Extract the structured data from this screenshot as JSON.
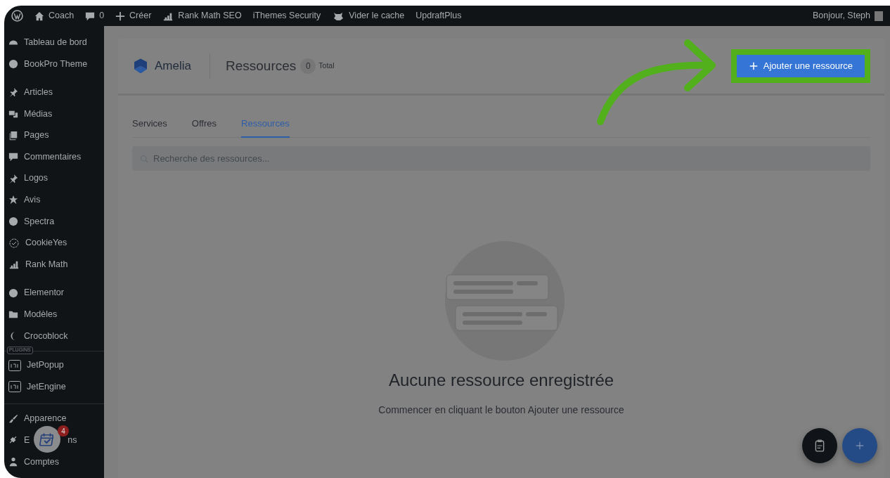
{
  "admin_bar": {
    "items": [
      {
        "label": "Coach",
        "kind": "home"
      },
      {
        "label": "0",
        "kind": "comments"
      },
      {
        "label": "Créer",
        "kind": "new"
      },
      {
        "label": "Rank Math SEO",
        "kind": "rankmath"
      },
      {
        "label": "iThemes Security",
        "kind": "plain"
      },
      {
        "label": "Vider le cache",
        "kind": "cache"
      },
      {
        "label": "UpdraftPlus",
        "kind": "plain"
      }
    ],
    "greeting": "Bonjour, Steph"
  },
  "sidebar": {
    "groups": [
      {
        "items": [
          {
            "label": "Tableau de bord"
          },
          {
            "label": "BookPro Theme"
          }
        ]
      },
      {
        "items": [
          {
            "label": "Articles"
          },
          {
            "label": "Médias"
          },
          {
            "label": "Pages"
          },
          {
            "label": "Commentaires"
          },
          {
            "label": "Logos"
          },
          {
            "label": "Avis"
          },
          {
            "label": "Spectra"
          },
          {
            "label": "CookieYes"
          },
          {
            "label": "Rank Math"
          }
        ]
      },
      {
        "items": [
          {
            "label": "Elementor"
          },
          {
            "label": "Modèles"
          },
          {
            "label": "Crocoblock"
          }
        ]
      },
      {
        "heading": "PLUGINS",
        "items": [
          {
            "label": "JetPopup"
          },
          {
            "label": "JetEngine"
          }
        ]
      },
      {
        "items": [
          {
            "label": "Apparence"
          },
          {
            "label_parts": [
              "E",
              "ns"
            ]
          },
          {
            "label": "Comptes"
          }
        ]
      }
    ]
  },
  "header": {
    "brand": "Amelia",
    "title": "Ressources",
    "count": "0",
    "count_label": "Total",
    "add_button": "Ajouter une ressource"
  },
  "tabs": [
    {
      "label": "Services",
      "selected": false
    },
    {
      "label": "Offres",
      "selected": false
    },
    {
      "label": "Ressources",
      "selected": true
    }
  ],
  "search": {
    "placeholder": "Recherche des ressources..."
  },
  "empty_state": {
    "title": "Aucune ressource enregistrée",
    "message": "Commencer en cliquant le bouton Ajouter une ressource"
  },
  "calendar_widget": {
    "badge": "4"
  }
}
